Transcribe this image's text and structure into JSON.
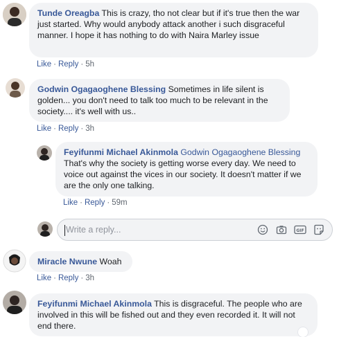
{
  "comments": [
    {
      "author": "Tunde Oreagba",
      "text": "This is crazy, tho not clear but if it's true then the war just started. Why would anybody attack another i such disgraceful manner. I hope it has nothing to do with Naira Marley issue",
      "time": "5h"
    },
    {
      "author": "Godwin Ogagaoghene Blessing",
      "text": "Sometimes in life silent is golden... you don't need to talk too much to be relevant in the society.... it's well with us..",
      "time": "3h"
    },
    {
      "author": "Feyifunmi Michael Akinmola",
      "mention": "Godwin Ogagaoghene Blessing",
      "text": "That's why the society is getting worse every day. We need to voice out against the vices in our society. It doesn't matter if we are the only one talking.",
      "time": "59m"
    },
    {
      "author": "Miracle Nwune",
      "text": "Woah",
      "time": "3h"
    },
    {
      "author": "Feyifunmi Michael Akinmola",
      "text": "This is disgraceful. The people who are involved in this will be fished out and they even recorded it. It will not end there."
    }
  ],
  "actions": {
    "like": "Like",
    "reply": "Reply"
  },
  "reply_box": {
    "placeholder": "Write a reply..."
  },
  "colors": {
    "link": "#385898",
    "bubble": "#f2f3f5",
    "meta": "#606770"
  }
}
